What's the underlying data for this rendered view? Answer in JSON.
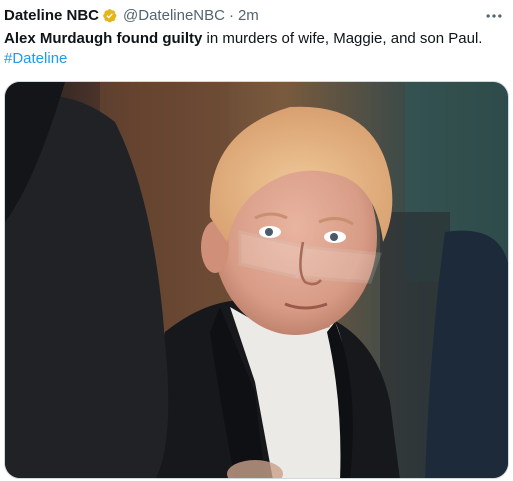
{
  "tweet": {
    "author": {
      "display_name": "Dateline NBC",
      "verified_icon": "verified-badge-gold-icon",
      "handle": "@DatelineNBC",
      "separator": "·",
      "time": "2m"
    },
    "more_icon": "more-horizontal-icon",
    "text": {
      "bold": "Alex Murdaugh found guilty",
      "rest": " in murders of wife, Maggie, and son Paul.",
      "hashtag": "#Dateline"
    },
    "media": {
      "alt": "photo"
    }
  },
  "colors": {
    "text": "#0f1419",
    "secondary": "#536471",
    "link": "#1d9bf0",
    "verified": "#e2b719"
  }
}
